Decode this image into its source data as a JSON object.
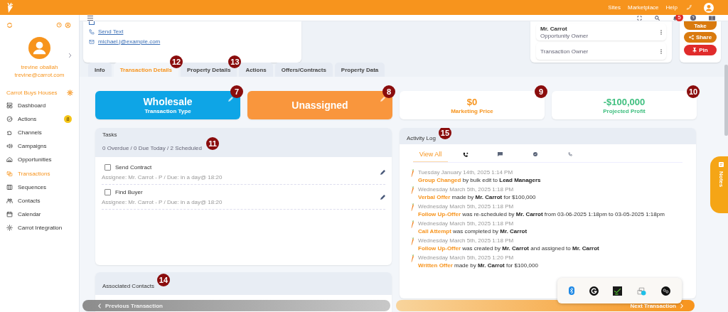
{
  "top_bar": {
    "links": [
      "Sites",
      "Marketplace",
      "Help"
    ]
  },
  "sidebar": {
    "user_name": "trevine oballah",
    "user_email": "trevine@carrot.com",
    "company": "Carrot Buys Houses",
    "nav": [
      {
        "label": "Dashboard",
        "selected": false
      },
      {
        "label": "Actions",
        "selected": false,
        "badge": "8"
      },
      {
        "label": "Channels",
        "selected": false
      },
      {
        "label": "Campaigns",
        "selected": false
      },
      {
        "label": "Opportunities",
        "selected": false
      },
      {
        "label": "Transactions",
        "selected": true
      },
      {
        "label": "Sequences",
        "selected": false
      },
      {
        "label": "Contacts",
        "selected": false
      },
      {
        "label": "Calendar",
        "selected": false
      },
      {
        "label": "Carrot Integration",
        "selected": false
      }
    ]
  },
  "toolbar": {
    "notification_count": "5"
  },
  "contact_card": {
    "links": [
      "Send Text",
      "michael.j@example.com"
    ]
  },
  "owners": [
    {
      "name": "Mr. Carrot",
      "role": "Opportunity Owner"
    },
    {
      "role": "Transaction Owner"
    }
  ],
  "quick_actions": [
    {
      "label": "Take",
      "kind": "plain"
    },
    {
      "label": "Share",
      "kind": "share"
    },
    {
      "label": "Pin",
      "kind": "pin"
    }
  ],
  "tabs": [
    {
      "label": "Info",
      "selected": false
    },
    {
      "label": "Transaction Details",
      "selected": true,
      "marker": "12"
    },
    {
      "label": "Property Details",
      "selected": false,
      "marker": "13"
    },
    {
      "label": "Actions",
      "selected": false
    },
    {
      "label": "Offers/Contracts",
      "selected": false
    },
    {
      "label": "Property Data",
      "selected": false
    }
  ],
  "stat_cards": [
    {
      "kind": "type",
      "value": "Wholesale",
      "label": "Transaction Type",
      "editable": true,
      "marker": "7"
    },
    {
      "kind": "status",
      "value": "Unassigned",
      "editable": true,
      "marker": "8"
    },
    {
      "kind": "price",
      "value": "$0",
      "label": "Marketing Price",
      "marker": "9"
    },
    {
      "kind": "profit",
      "value": "-$100,000",
      "label": "Projected Profit",
      "marker": "10"
    }
  ],
  "tasks": {
    "title": "Tasks",
    "summary": "0 Overdue / 0 Due Today / 2 Scheduled",
    "marker": "11",
    "items": [
      {
        "title": "Send Contract",
        "meta": "Assignee: Mr. Carrot - P / Due: in a day@ 18:20",
        "checked": false
      },
      {
        "title": "Find Buyer",
        "meta": "Assignee: Mr. Carrot - P / Due: in a day@ 18:20",
        "checked": false
      }
    ]
  },
  "associated_contacts": {
    "title": "Associated Contacts",
    "marker": "14"
  },
  "activity_log": {
    "title": "Activity Log",
    "marker": "15",
    "filters": [
      {
        "kind": "all",
        "label": "View All",
        "selected": true
      },
      {
        "kind": "calls",
        "selected": false
      },
      {
        "kind": "messages",
        "selected": false
      },
      {
        "kind": "tasks",
        "selected": false
      },
      {
        "kind": "call-attempts",
        "selected": false
      }
    ],
    "entries": [
      {
        "date": "Tuesday January 14th, 2025 1:14 PM",
        "event": "Group Changed",
        "text": "by bulk edit to **Lead Managers**"
      },
      {
        "date": "Wednesday March 5th, 2025 1:18 PM",
        "event": "Verbal Offer",
        "text": "made by **Mr. Carrot** for $100,000"
      },
      {
        "date": "Wednesday March 5th, 2025 1:18 PM",
        "event": "Follow Up-Offer",
        "text": "was re-scheduled by **Mr. Carrot** from 03-06-2025 1:18pm to 03-05-2025 1:18pm"
      },
      {
        "date": "Wednesday March 5th, 2025 1:18 PM",
        "event": "Call Attempt",
        "text": "was completed by **Mr. Carrot**"
      },
      {
        "date": "Wednesday March 5th, 2025 1:18 PM",
        "event": "Follow Up-Offer",
        "text": "was created by **Mr. Carrot** and assigned to **Mr. Carrot**"
      },
      {
        "date": "Wednesday March 5th, 2025 1:20 PM",
        "event": "Written Offer",
        "text": "made by **Mr. Carrot** for $100,000"
      }
    ]
  },
  "notes_tab": {
    "label": "Notes"
  },
  "pager": {
    "previous": "Previous Transaction",
    "next": "Next Transaction"
  },
  "tray": [
    {
      "kind": "bluetooth"
    },
    {
      "kind": "g-logo"
    },
    {
      "kind": "terminal"
    },
    {
      "kind": "cloud-sync"
    },
    {
      "kind": "bo-logo"
    }
  ]
}
